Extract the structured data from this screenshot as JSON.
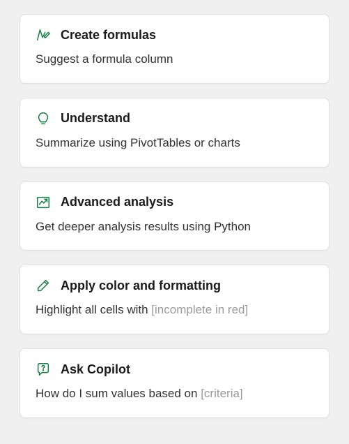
{
  "cards": [
    {
      "title": "Create formulas",
      "description": "Suggest a formula column",
      "placeholder": "",
      "icon": "formula-pen-icon"
    },
    {
      "title": "Understand",
      "description": "Summarize using PivotTables or charts",
      "placeholder": "",
      "icon": "lightbulb-icon"
    },
    {
      "title": "Advanced analysis",
      "description": "Get deeper analysis results using Python",
      "placeholder": "",
      "icon": "trend-arrow-icon"
    },
    {
      "title": "Apply color and formatting",
      "description": "Highlight all cells with ",
      "placeholder": "[incomplete in red]",
      "icon": "pencil-icon"
    },
    {
      "title": "Ask Copilot",
      "description": "How do I sum values based on ",
      "placeholder": "[criteria]",
      "icon": "chat-question-icon"
    }
  ]
}
